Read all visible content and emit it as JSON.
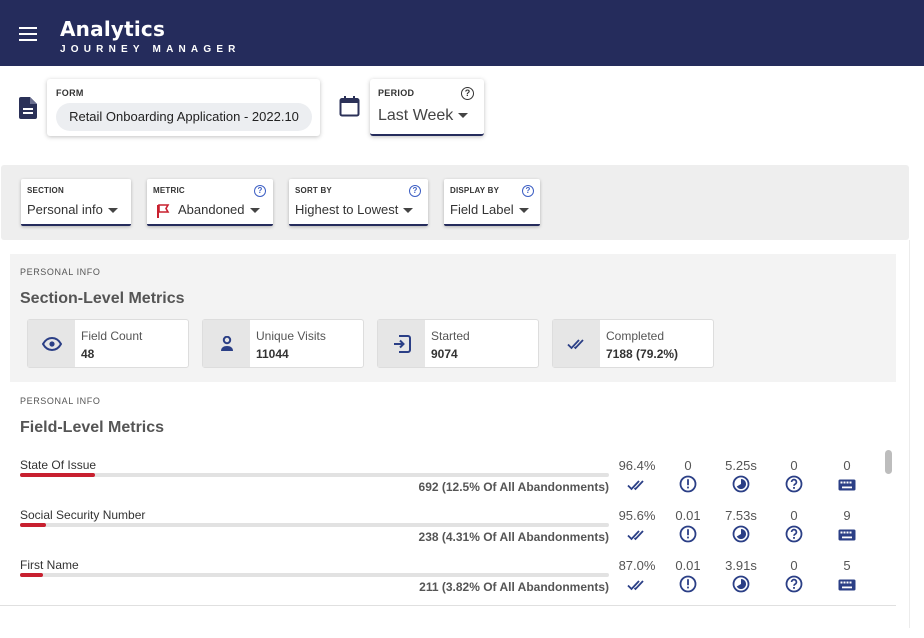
{
  "header": {
    "title": "Analytics",
    "subtitle": "JOURNEY MANAGER"
  },
  "icons": {
    "menu": "menu-icon",
    "form": "document-icon",
    "calendar": "calendar-icon",
    "help": "help-circle-icon",
    "flag": "flag-icon",
    "eye": "eye-icon",
    "person": "person-icon",
    "login": "login-icon",
    "double_check": "double-check-icon",
    "error": "exclamation-circle-icon",
    "timer": "timer-icon",
    "keyboard": "keyboard-icon"
  },
  "colors": {
    "header_bg": "#252c5c",
    "accent": "#252c5c",
    "icon_blue": "#2b3f86",
    "abandon_red": "#c8202f",
    "band_gray": "#eeeeee"
  },
  "form": {
    "label": "FORM",
    "value": "Retail Onboarding Application - 2022.10"
  },
  "period": {
    "label": "PERIOD",
    "value": "Last Week",
    "help": "?"
  },
  "filters": [
    {
      "label": "SECTION",
      "value": "Personal info"
    },
    {
      "label": "METRIC",
      "value": "Abandoned",
      "help": "?"
    },
    {
      "label": "SORT BY",
      "value": "Highest to Lowest",
      "help": "?"
    },
    {
      "label": "DISPLAY BY",
      "value": "Field Label",
      "help": "?"
    }
  ],
  "section_metrics": {
    "caption": "PERSONAL INFO",
    "title": "Section-Level Metrics",
    "cards": [
      {
        "label": "Field Count",
        "value": "48"
      },
      {
        "label": "Unique Visits",
        "value": "11044"
      },
      {
        "label": "Started",
        "value": "9074"
      },
      {
        "label": "Completed",
        "value": "7188 (79.2%)"
      }
    ]
  },
  "field_metrics": {
    "caption": "PERSONAL INFO",
    "title": "Field-Level Metrics",
    "rows": [
      {
        "name": "State Of Issue",
        "abandonments": "692 (12.5% Of All Abandonments)",
        "abandon_share": 0.125,
        "completion": "96.4%",
        "errors": "0",
        "time": "5.25s",
        "help": "0",
        "keys": "0"
      },
      {
        "name": "Social Security Number",
        "abandonments": "238 (4.31% Of All Abandonments)",
        "abandon_share": 0.0431,
        "completion": "95.6%",
        "errors": "0.01",
        "time": "7.53s",
        "help": "0",
        "keys": "9"
      },
      {
        "name": "First Name",
        "abandonments": "211 (3.82% Of All Abandonments)",
        "abandon_share": 0.0382,
        "completion": "87.0%",
        "errors": "0.01",
        "time": "3.91s",
        "help": "0",
        "keys": "5"
      }
    ]
  }
}
